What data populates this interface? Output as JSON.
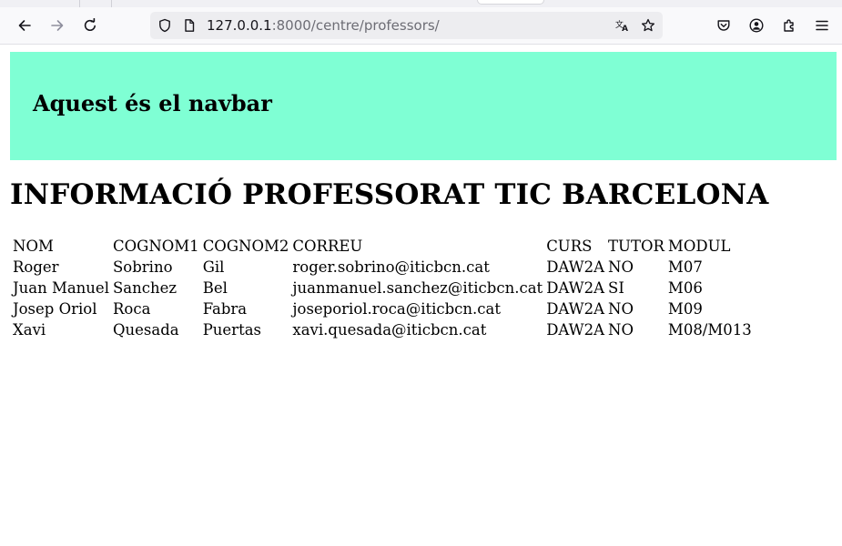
{
  "browser": {
    "url_host": "127.0.0.1",
    "url_path": ":8000/centre/professors/"
  },
  "navbar": {
    "title": "Aquest és el navbar",
    "background": "#7fffd4"
  },
  "page": {
    "title": "INFORMACIÓ PROFESSORAT TIC BARCELONA"
  },
  "table": {
    "headers": [
      "NOM",
      "COGNOM1",
      "COGNOM2",
      "CORREU",
      "CURS",
      "TUTOR",
      "MODUL"
    ],
    "rows": [
      [
        "Roger",
        "Sobrino",
        "Gil",
        "roger.sobrino@iticbcn.cat",
        "DAW2A",
        "NO",
        "M07"
      ],
      [
        "Juan Manuel",
        "Sanchez",
        "Bel",
        "juanmanuel.sanchez@iticbcn.cat",
        "DAW2A",
        "SI",
        "M06"
      ],
      [
        "Josep Oriol",
        "Roca",
        "Fabra",
        "joseporiol.roca@iticbcn.cat",
        "DAW2A",
        "NO",
        "M09"
      ],
      [
        "Xavi",
        "Quesada",
        "Puertas",
        "xavi.quesada@iticbcn.cat",
        "DAW2A",
        "NO",
        "M08/M013"
      ]
    ]
  },
  "icons": {
    "back": "arrow-left-icon",
    "forward": "arrow-right-icon",
    "reload": "reload-icon",
    "shield": "shield-icon",
    "page": "page-icon",
    "translate": "translate-icon",
    "bookmark": "star-icon",
    "pocket": "pocket-icon",
    "account": "account-icon",
    "extensions": "puzzle-icon",
    "menu": "hamburger-menu-icon"
  }
}
